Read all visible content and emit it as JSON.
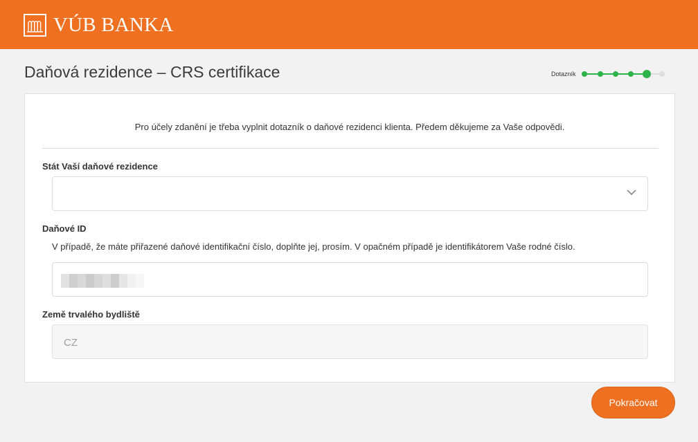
{
  "header": {
    "brand": "VÚB BANKA",
    "brand_color": "#ee7020"
  },
  "page": {
    "title": "Daňová rezidence – CRS certifikace"
  },
  "progress": {
    "label": "Dotazník",
    "total_steps": 6,
    "current_step": 5,
    "done_color": "#2db34a",
    "todo_color": "#dddddd"
  },
  "form": {
    "intro": "Pro účely zdanění je třeba vyplnit dotazník o daňové rezidenci klienta. Předem děkujeme za Vaše odpovědi.",
    "residence": {
      "label": "Stát Vaší daňové rezidence",
      "value": "",
      "icon": "chevron-down-icon"
    },
    "tax_id": {
      "label": "Daňové ID",
      "help": "V případě, že máte přiřazené daňové identifikační číslo, doplňte jej, prosím. V opačném případě je identifikátorem Vaše rodné číslo.",
      "value_redacted": true
    },
    "permanent_residence": {
      "label": "Země trvalého bydliště",
      "value": "CZ"
    }
  },
  "actions": {
    "continue_label": "Pokračovat"
  }
}
